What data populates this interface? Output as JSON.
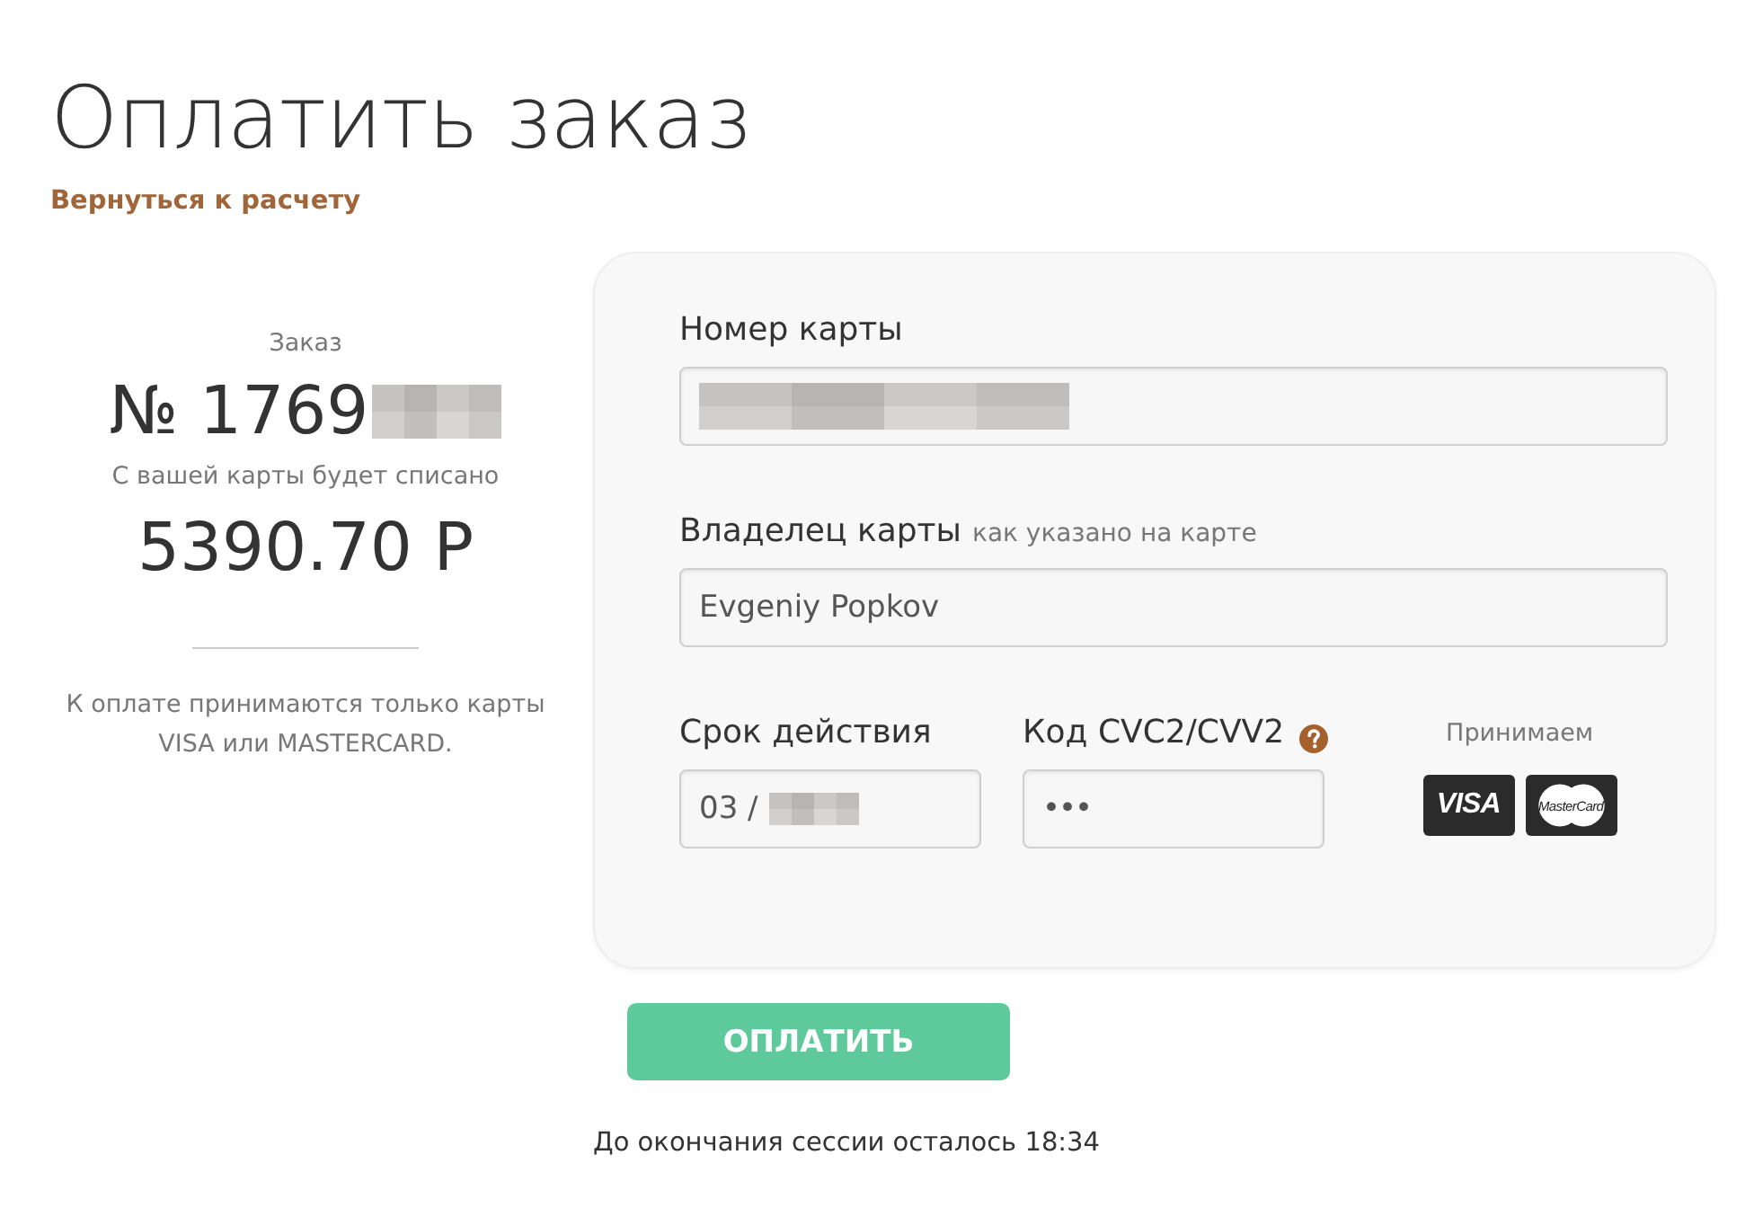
{
  "page": {
    "title": "Оплатить заказ",
    "back_link": "Вернуться к расчету"
  },
  "order": {
    "label": "Заказ",
    "number": "№ 1769",
    "number_redacted": true,
    "charge_label": "С вашей карты будет списано",
    "amount": "5390.70 Р",
    "note": "К оплате принимаются только карты VISA или MASTERCARD."
  },
  "form": {
    "fields": [
      {
        "label": "Номер карты",
        "value_redacted": true
      },
      {
        "label": "Владелец карты",
        "hint": "как указано на карте",
        "value": "Evgeniy Popkov"
      }
    ],
    "row": [
      {
        "kind": "expiry",
        "label": "Срок действия",
        "value": "03 /",
        "value_redacted": true
      },
      {
        "kind": "cvc",
        "label": "Код CVC2/CVV2",
        "help": true,
        "value": "•••"
      }
    ],
    "accepted": {
      "label": "Принимаем",
      "cards": [
        {
          "kind": "visa",
          "label": "VISA"
        },
        {
          "kind": "mastercard",
          "label": "MasterCard"
        }
      ]
    }
  },
  "pay_button": "ОПЛАТИТЬ",
  "session_note": "До окончания сессии осталось 18:34"
}
